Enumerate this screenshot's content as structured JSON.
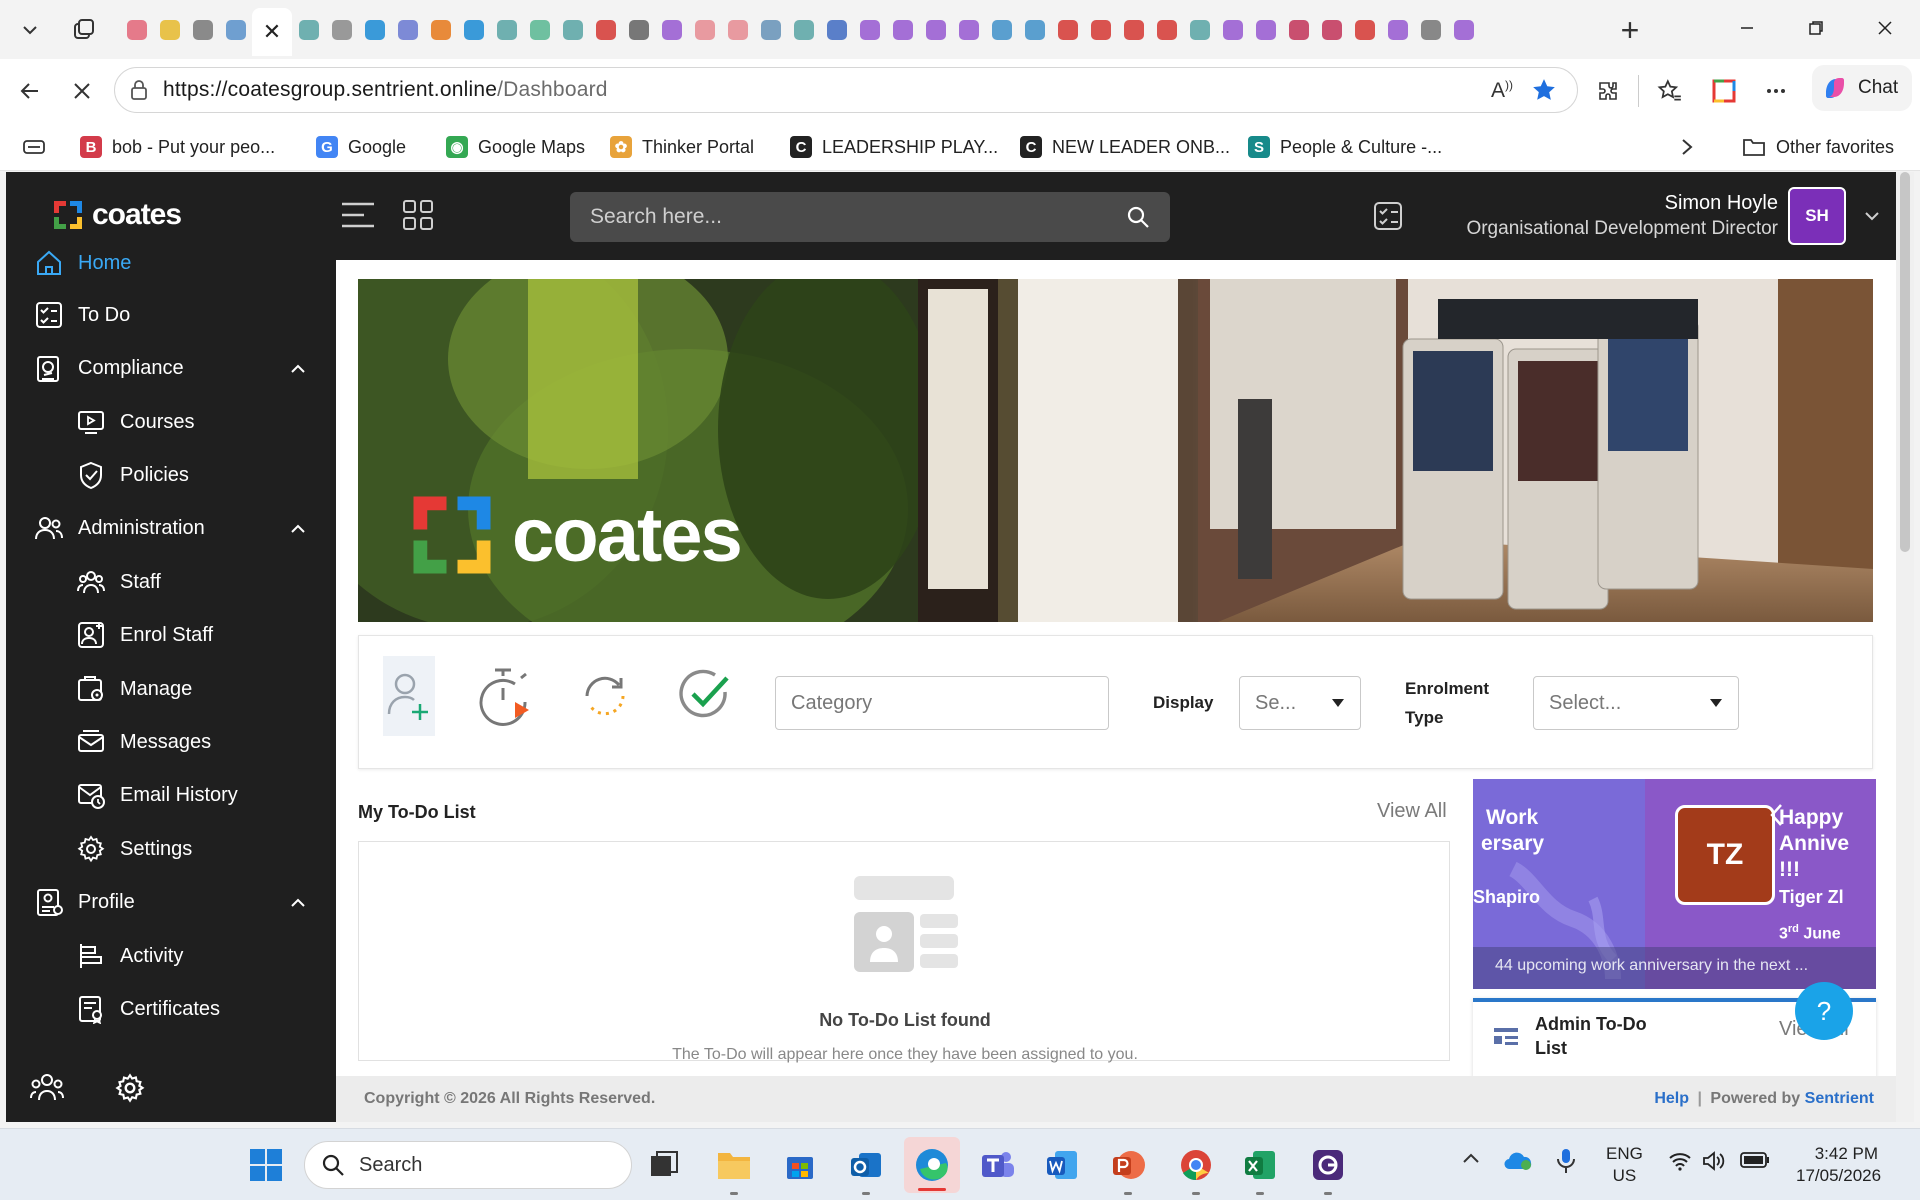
{
  "browser": {
    "url_host": "https://coatesgroup.sentrient.online",
    "url_path": "/Dashboard",
    "chat_label": "Chat",
    "other_favorites": "Other favorites",
    "favorites": [
      {
        "label": "bob - Put your peo...",
        "color": "#d33b4a",
        "glyph": "B"
      },
      {
        "label": "Google",
        "color": "#4285f4",
        "glyph": "G"
      },
      {
        "label": "Google Maps",
        "color": "#34a853",
        "glyph": "◉"
      },
      {
        "label": "Thinker Portal",
        "color": "#e8a33b",
        "glyph": "✿"
      },
      {
        "label": "LEADERSHIP PLAY...",
        "color": "#222222",
        "glyph": "C"
      },
      {
        "label": "NEW LEADER ONB...",
        "color": "#222222",
        "glyph": "C"
      },
      {
        "label": "People & Culture -...",
        "color": "#178a8a",
        "glyph": "S"
      }
    ],
    "tab_colors": [
      "#e57a8a",
      "#e8c24a",
      "#8a8a8a",
      "#6f9fd0",
      "#6fb0b0",
      "#999999",
      "#3a9ad9",
      "#7d8ad6",
      "#e88a3a",
      "#3a9ad9",
      "#6fb0b0",
      "#6fc0a0",
      "#6fb0b0",
      "#d9534f",
      "#777777",
      "#a46fd6",
      "#e89aa0",
      "#e89aa0",
      "#7aa0c0",
      "#6fb0b0",
      "#5a7fc9",
      "#a46fd6",
      "#a46fd6",
      "#a46fd6",
      "#a46fd6",
      "#5a9fcf",
      "#5a9fcf",
      "#d9534f",
      "#d9534f",
      "#d9534f",
      "#d9534f",
      "#6fb0b0",
      "#a46fd6",
      "#a46fd6",
      "#c94f6f",
      "#c94f6f",
      "#d9534f",
      "#a46fd6",
      "#888888",
      "#a46fd6"
    ]
  },
  "app": {
    "brand": "coates",
    "search_placeholder": "Search here...",
    "user_name": "Simon Hoyle",
    "user_role": "Organisational Development Director",
    "user_initials": "SH"
  },
  "sidebar": {
    "items": [
      {
        "label": "Home",
        "icon": "home-icon",
        "active": true
      },
      {
        "label": "To Do",
        "icon": "checklist-icon"
      },
      {
        "label": "Compliance",
        "icon": "compliance-icon",
        "expandable": true
      },
      {
        "label": "Courses",
        "icon": "play-screen-icon",
        "sub": true
      },
      {
        "label": "Policies",
        "icon": "shield-check-icon",
        "sub": true
      },
      {
        "label": "Administration",
        "icon": "users-icon",
        "expandable": true
      },
      {
        "label": "Staff",
        "icon": "staff-group-icon",
        "sub": true
      },
      {
        "label": "Enrol Staff",
        "icon": "enrol-icon",
        "sub": true
      },
      {
        "label": "Manage",
        "icon": "manage-icon",
        "sub": true
      },
      {
        "label": "Messages",
        "icon": "messages-icon",
        "sub": true
      },
      {
        "label": "Email History",
        "icon": "email-history-icon",
        "sub": true
      },
      {
        "label": "Settings",
        "icon": "gear-icon",
        "sub": true
      },
      {
        "label": "Profile",
        "icon": "profile-icon",
        "expandable": true
      },
      {
        "label": "Activity",
        "icon": "activity-icon",
        "sub": true
      },
      {
        "label": "Certificates",
        "icon": "certificate-icon",
        "sub": true
      }
    ]
  },
  "banner": {
    "brand": "coates"
  },
  "filters": {
    "category_placeholder": "Category",
    "display_label": "Display",
    "display_value": "Se...",
    "enrolment_label_1": "Enrolment",
    "enrolment_label_2": "Type",
    "enrolment_value": "Select..."
  },
  "todo": {
    "title": "My To-Do List",
    "view_all": "View All",
    "empty_title": "No To-Do List found",
    "empty_sub": "The To-Do will appear here once they have been assigned to you."
  },
  "anniversary": {
    "left_title_1": "Work",
    "left_title_2": "ersary",
    "left_name": "Shapiro",
    "initials": "TZ",
    "right_title_1": "Happy",
    "right_title_2": "Annive",
    "right_title_3": "!!!",
    "right_name": "Tiger Zl",
    "date_day": "3",
    "date_suffix": "rd",
    "date_month": "June",
    "footer": "44 upcoming work anniversary in the next ..."
  },
  "admin_todo": {
    "title_1": "Admin To-Do",
    "title_2": "List",
    "view_all": "View All"
  },
  "footer": {
    "copyright": "Copyright © 2026 All Rights Reserved.",
    "help": "Help",
    "powered_by": "Powered by",
    "vendor": "Sentrient"
  },
  "taskbar": {
    "search_label": "Search",
    "lang_1": "ENG",
    "lang_2": "US",
    "time": "3:42 PM",
    "date": "17/05/2026"
  }
}
